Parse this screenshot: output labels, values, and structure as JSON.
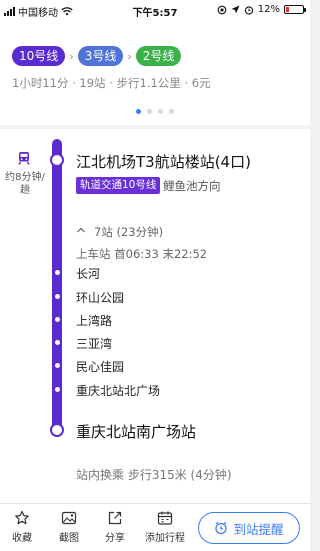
{
  "status_bar": {
    "carrier": "中国移动",
    "time": "下午5:57",
    "battery": "12%"
  },
  "route": {
    "lines": [
      {
        "label": "10号线",
        "color": "#5a2bd0"
      },
      {
        "label": "3号线",
        "color": "#4f73d6"
      },
      {
        "label": "2号线",
        "color": "#3cb04a"
      }
    ],
    "summary": "1小时11分 · 19站 · 步行1.1公里 · 6元",
    "page_count": 4,
    "current_page": 1
  },
  "segment": {
    "frequency": "约8分钟/趟",
    "start_station": "江北机场T3航站楼站(4口)",
    "line_tag": "轨道交通10号线",
    "direction": "鲤鱼池方向",
    "stops_toggle_icon": "chevron-up-icon",
    "stops_count": "7站 (23分钟)",
    "hours": "上车站 首06:33 末22:52",
    "stops": [
      "长河",
      "环山公园",
      "上湾路",
      "三亚湾",
      "民心佳园",
      "重庆北站北广场"
    ],
    "end_station": "重庆北站南广场站",
    "transfer": "站内换乘 步行315米 (4分钟)",
    "line_color": "#5a2bd0"
  },
  "toolbar": {
    "collect": "收藏",
    "screenshot": "截图",
    "share": "分享",
    "add_trip": "添加行程",
    "remind": "到站提醒",
    "accent": "#3d7bf5"
  }
}
